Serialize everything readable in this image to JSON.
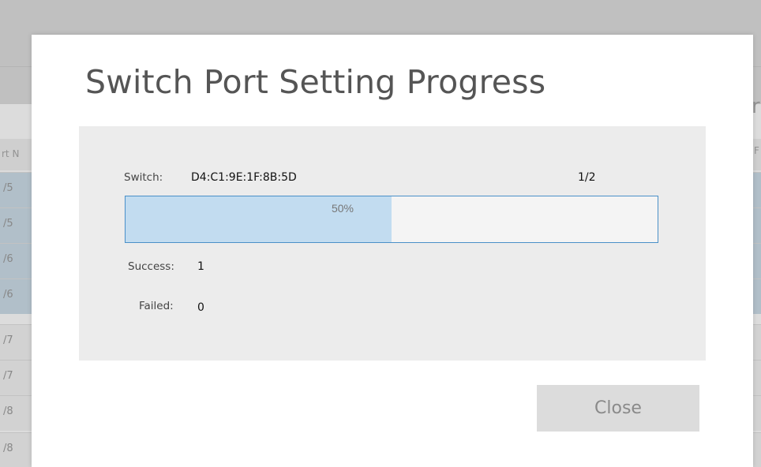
{
  "background": {
    "column_header": "rt N",
    "rows": [
      {
        "text": "/5",
        "selected": true
      },
      {
        "text": "/5",
        "selected": true
      },
      {
        "text": "/6",
        "selected": true
      },
      {
        "text": "/6",
        "selected": true
      },
      {
        "text": "/7",
        "selected": false
      },
      {
        "text": "/7",
        "selected": false
      },
      {
        "text": "/8",
        "selected": false
      },
      {
        "text": "/8",
        "selected": false
      }
    ],
    "right_header_fragment": "r",
    "right_column_fragment": "F"
  },
  "modal": {
    "title": "Switch Port Setting Progress",
    "switch_label": "Switch:",
    "switch_id": "D4:C1:9E:1F:8B:5D",
    "switch_count": "1/2",
    "progress": {
      "percent": 50,
      "text": "50%"
    },
    "success_label": "Success:",
    "success_value": "1",
    "failed_label": "Failed:",
    "failed_value": "0",
    "close_label": "Close"
  },
  "colors": {
    "progress_fill": "#c2dcf0",
    "progress_border": "#4a90c8",
    "selected_row": "#c4d7e5"
  }
}
